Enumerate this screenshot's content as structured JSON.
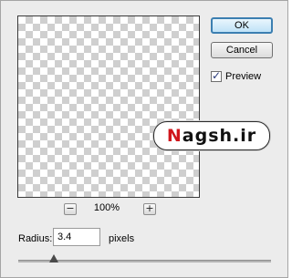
{
  "buttons": {
    "ok": "OK",
    "cancel": "Cancel"
  },
  "preview_toggle": {
    "label": "Preview",
    "checked": true,
    "check_glyph": "✓"
  },
  "zoom": {
    "out_symbol": "−",
    "in_symbol": "+",
    "level": "100%"
  },
  "radius": {
    "label": "Radius:",
    "value": "3.4",
    "unit": "pixels",
    "slider_fraction": 0.14
  },
  "watermark": {
    "first_letter": "N",
    "rest": "agsh.ir"
  },
  "colors": {
    "ok_border": "#3c7fb1",
    "watermark_accent": "#d0161c"
  }
}
